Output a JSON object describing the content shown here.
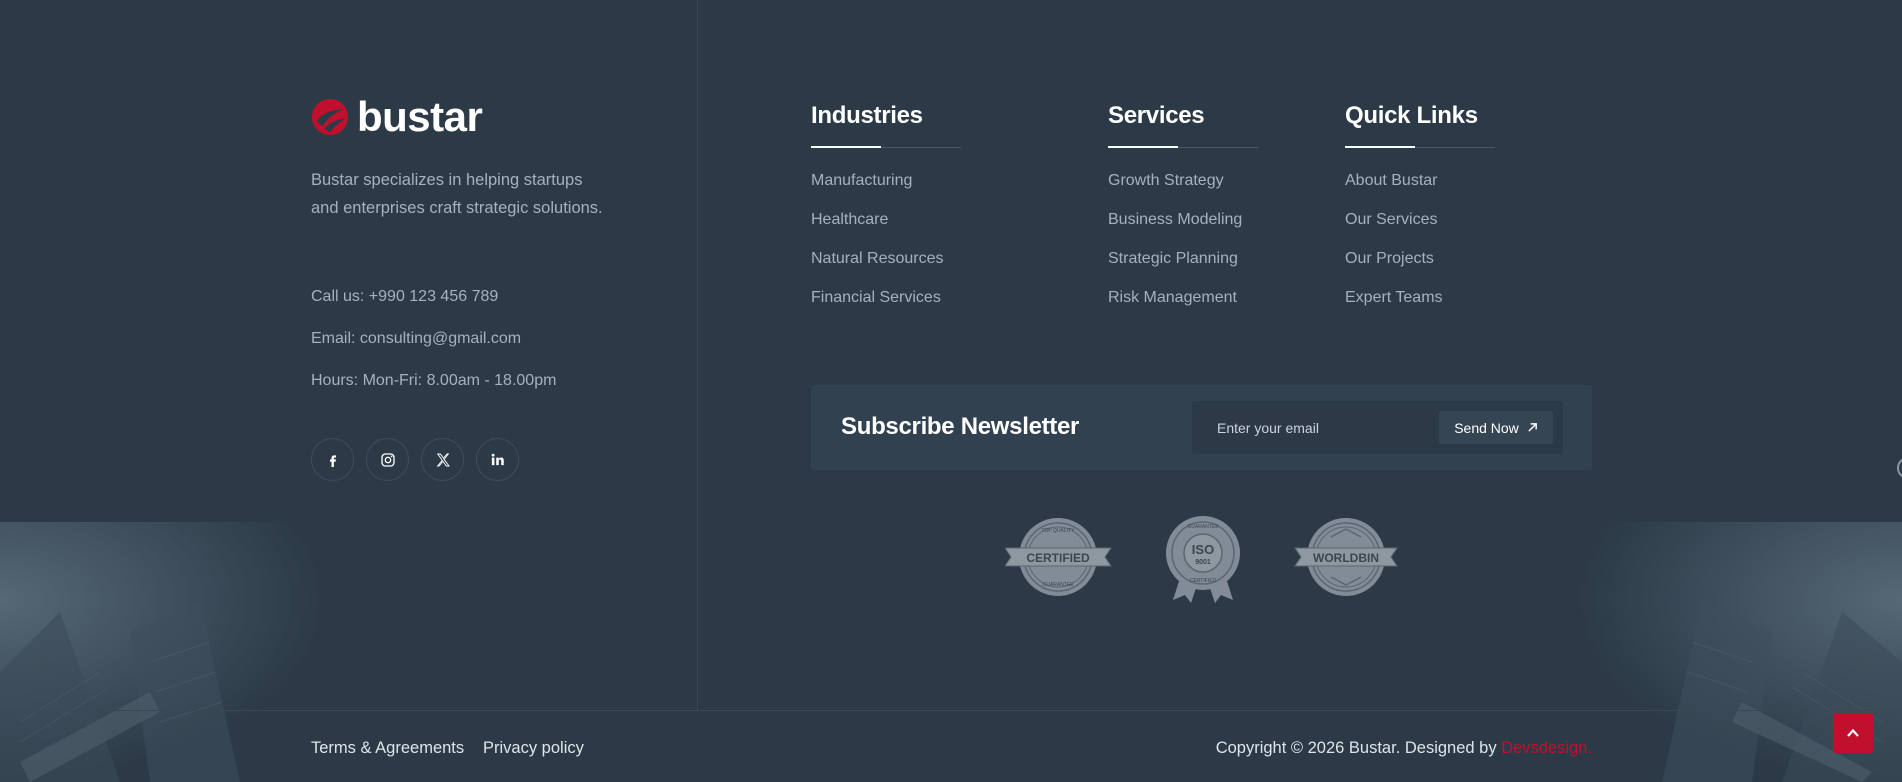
{
  "brand": {
    "name": "bustar",
    "accent_color": "#c0102e",
    "tagline": "Bustar specializes in helping startups and enterprises craft strategic solutions."
  },
  "contact": {
    "phone": "Call us: +990 123 456 789",
    "email": "Email: consulting@gmail.com",
    "hours": "Hours: Mon-Fri: 8.00am - 18.00pm"
  },
  "socials": [
    {
      "name": "facebook-icon"
    },
    {
      "name": "instagram-icon"
    },
    {
      "name": "x-icon"
    },
    {
      "name": "linkedin-icon"
    }
  ],
  "columns": {
    "industries": {
      "title": "Industries",
      "items": [
        "Manufacturing",
        "Healthcare",
        "Natural Resources",
        "Financial Services"
      ]
    },
    "services": {
      "title": "Services",
      "items": [
        "Growth Strategy",
        "Business Modeling",
        "Strategic Planning",
        "Risk Management"
      ]
    },
    "quick_links": {
      "title": "Quick Links",
      "items": [
        "About Bustar",
        "Our Services",
        "Our Projects",
        "Expert Teams"
      ]
    }
  },
  "newsletter": {
    "title": "Subscribe Newsletter",
    "placeholder": "Enter your email",
    "button_label": "Send Now"
  },
  "badges": {
    "certified": {
      "label": "CERTIFIED",
      "top_text": "TOP QUALITY",
      "bottom_text": "GUARANTEE"
    },
    "iso": {
      "label": "ISO",
      "number": "9001",
      "top_text": "GUARANTEE",
      "bottom_text": "CERTIFIED"
    },
    "worldbin": {
      "label": "WORLDBIN"
    }
  },
  "footer": {
    "terms": "Terms & Agreements",
    "privacy": "Privacy policy",
    "copyright": "Copyright © 2026 Bustar. Designed by ",
    "designer": "Devsdesign."
  }
}
